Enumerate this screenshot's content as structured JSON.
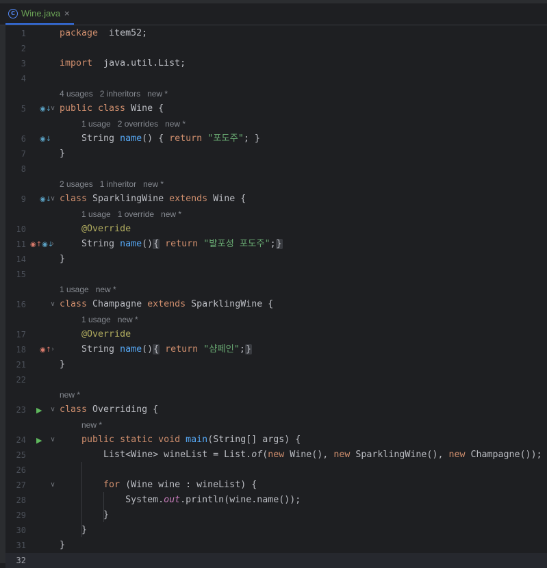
{
  "tab": {
    "title": "Wine.java",
    "close": "×",
    "icon": "C"
  },
  "colors": {
    "keyword": "#cf8e6d",
    "string": "#6aab73",
    "function": "#56a8f5",
    "annotation": "#b3ae60",
    "static_field": "#c77dbb",
    "text": "#bcbec4",
    "hint": "#868a91"
  },
  "editor": {
    "current_line": "32",
    "lines": [
      {
        "ln": "1",
        "tokens": [
          [
            "kw",
            "package"
          ],
          [
            "",
            "  item52;"
          ]
        ]
      },
      {
        "ln": "2",
        "tokens": []
      },
      {
        "ln": "3",
        "tokens": [
          [
            "kw",
            "import"
          ],
          [
            "",
            "  java.util.List;"
          ]
        ]
      },
      {
        "ln": "4",
        "tokens": []
      },
      {
        "hint": "4 usages   2 inheritors   new *",
        "indent": 0
      },
      {
        "ln": "5",
        "gutter": [
          [
            "override-icon",
            "◉↓"
          ]
        ],
        "fold": "∨",
        "tokens": [
          [
            "kw",
            "public class"
          ],
          [
            "",
            " Wine {"
          ]
        ]
      },
      {
        "hint": "1 usage   2 overrides   new *",
        "indent": 4
      },
      {
        "ln": "6",
        "gutter": [
          [
            "override-icon",
            "◉↓"
          ]
        ],
        "tokens": [
          [
            "",
            "    String "
          ],
          [
            "fn",
            "name"
          ],
          [
            "",
            "() { "
          ],
          [
            "kw",
            "return"
          ],
          [
            "",
            " "
          ],
          [
            "str",
            "\"포도주\""
          ],
          [
            "",
            "; }"
          ]
        ]
      },
      {
        "ln": "7",
        "tokens": [
          [
            "",
            "}"
          ]
        ]
      },
      {
        "ln": "8",
        "tokens": []
      },
      {
        "hint": "2 usages   1 inheritor   new *",
        "indent": 0
      },
      {
        "ln": "9",
        "gutter": [
          [
            "override-icon",
            "◉↓"
          ]
        ],
        "fold": "∨",
        "tokens": [
          [
            "kw",
            "class"
          ],
          [
            "",
            " SparklingWine "
          ],
          [
            "kw",
            "extends"
          ],
          [
            "",
            " Wine {"
          ]
        ]
      },
      {
        "hint": "1 usage   1 override   new *",
        "indent": 4
      },
      {
        "ln": "10",
        "tokens": [
          [
            "",
            "    "
          ],
          [
            "ann",
            "@Override"
          ]
        ]
      },
      {
        "ln": "11",
        "gutter": [
          [
            "implemented-icon",
            "◉↑"
          ],
          [
            "override-icon",
            "◉↓"
          ]
        ],
        "fold": "›",
        "tokens": [
          [
            "",
            "    String "
          ],
          [
            "fn",
            "name"
          ],
          [
            "",
            "()"
          ],
          [
            "fr",
            "{"
          ],
          [
            "",
            " "
          ],
          [
            "kw",
            "return"
          ],
          [
            "",
            " "
          ],
          [
            "str",
            "\"발포성 포도주\""
          ],
          [
            "",
            ";"
          ],
          [
            "fr",
            "}"
          ]
        ]
      },
      {
        "ln": "14",
        "tokens": [
          [
            "",
            "}"
          ]
        ]
      },
      {
        "ln": "15",
        "tokens": []
      },
      {
        "hint": "1 usage   new *",
        "indent": 0
      },
      {
        "ln": "16",
        "fold": "∨",
        "tokens": [
          [
            "kw",
            "class"
          ],
          [
            "",
            " Champagne "
          ],
          [
            "kw",
            "extends"
          ],
          [
            "",
            " SparklingWine {"
          ]
        ]
      },
      {
        "hint": "1 usage   new *",
        "indent": 4
      },
      {
        "ln": "17",
        "tokens": [
          [
            "",
            "    "
          ],
          [
            "ann",
            "@Override"
          ]
        ]
      },
      {
        "ln": "18",
        "gutter": [
          [
            "implemented-icon",
            "◉↑"
          ]
        ],
        "fold": "›",
        "tokens": [
          [
            "",
            "    String "
          ],
          [
            "fn",
            "name"
          ],
          [
            "",
            "()"
          ],
          [
            "fr",
            "{"
          ],
          [
            "",
            " "
          ],
          [
            "kw",
            "return"
          ],
          [
            "",
            " "
          ],
          [
            "str",
            "\"샴페인\""
          ],
          [
            "",
            ";"
          ],
          [
            "fr",
            "}"
          ]
        ]
      },
      {
        "ln": "21",
        "tokens": [
          [
            "",
            "}"
          ]
        ]
      },
      {
        "ln": "22",
        "tokens": []
      },
      {
        "hint": "new *",
        "indent": 0
      },
      {
        "ln": "23",
        "gutter": [
          [
            "run-icon",
            "▶"
          ]
        ],
        "fold": "∨",
        "tokens": [
          [
            "kw",
            "class"
          ],
          [
            "",
            " Overriding {"
          ]
        ]
      },
      {
        "hint": "new *",
        "indent": 4
      },
      {
        "ln": "24",
        "gutter": [
          [
            "run-icon",
            "▶"
          ]
        ],
        "fold": "∨",
        "tokens": [
          [
            "",
            "    "
          ],
          [
            "kw",
            "public static void"
          ],
          [
            "",
            " "
          ],
          [
            "fn",
            "main"
          ],
          [
            "",
            "(String[] args) {"
          ]
        ]
      },
      {
        "ln": "25",
        "tokens": [
          [
            "",
            "        List<Wine> wineList = List."
          ],
          [
            "it",
            "of"
          ],
          [
            "",
            "("
          ],
          [
            "kw",
            "new"
          ],
          [
            "",
            " Wine(), "
          ],
          [
            "kw",
            "new"
          ],
          [
            "",
            " SparklingWine(), "
          ],
          [
            "kw",
            "new"
          ],
          [
            "",
            " Champagne());"
          ]
        ]
      },
      {
        "ln": "26",
        "tokens": []
      },
      {
        "ln": "27",
        "fold": "∨",
        "tokens": [
          [
            "",
            "        "
          ],
          [
            "kw",
            "for"
          ],
          [
            "",
            " (Wine wine : wineList) {"
          ]
        ]
      },
      {
        "ln": "28",
        "tokens": [
          [
            "",
            "            System."
          ],
          [
            "st",
            "out"
          ],
          [
            "",
            ".println(wine.name());"
          ]
        ]
      },
      {
        "ln": "29",
        "tokens": [
          [
            "",
            "        }"
          ]
        ]
      },
      {
        "ln": "30",
        "tokens": [
          [
            "",
            "    }"
          ]
        ]
      },
      {
        "ln": "31",
        "tokens": [
          [
            "",
            "}"
          ]
        ]
      },
      {
        "ln": "32",
        "tokens": []
      }
    ]
  }
}
